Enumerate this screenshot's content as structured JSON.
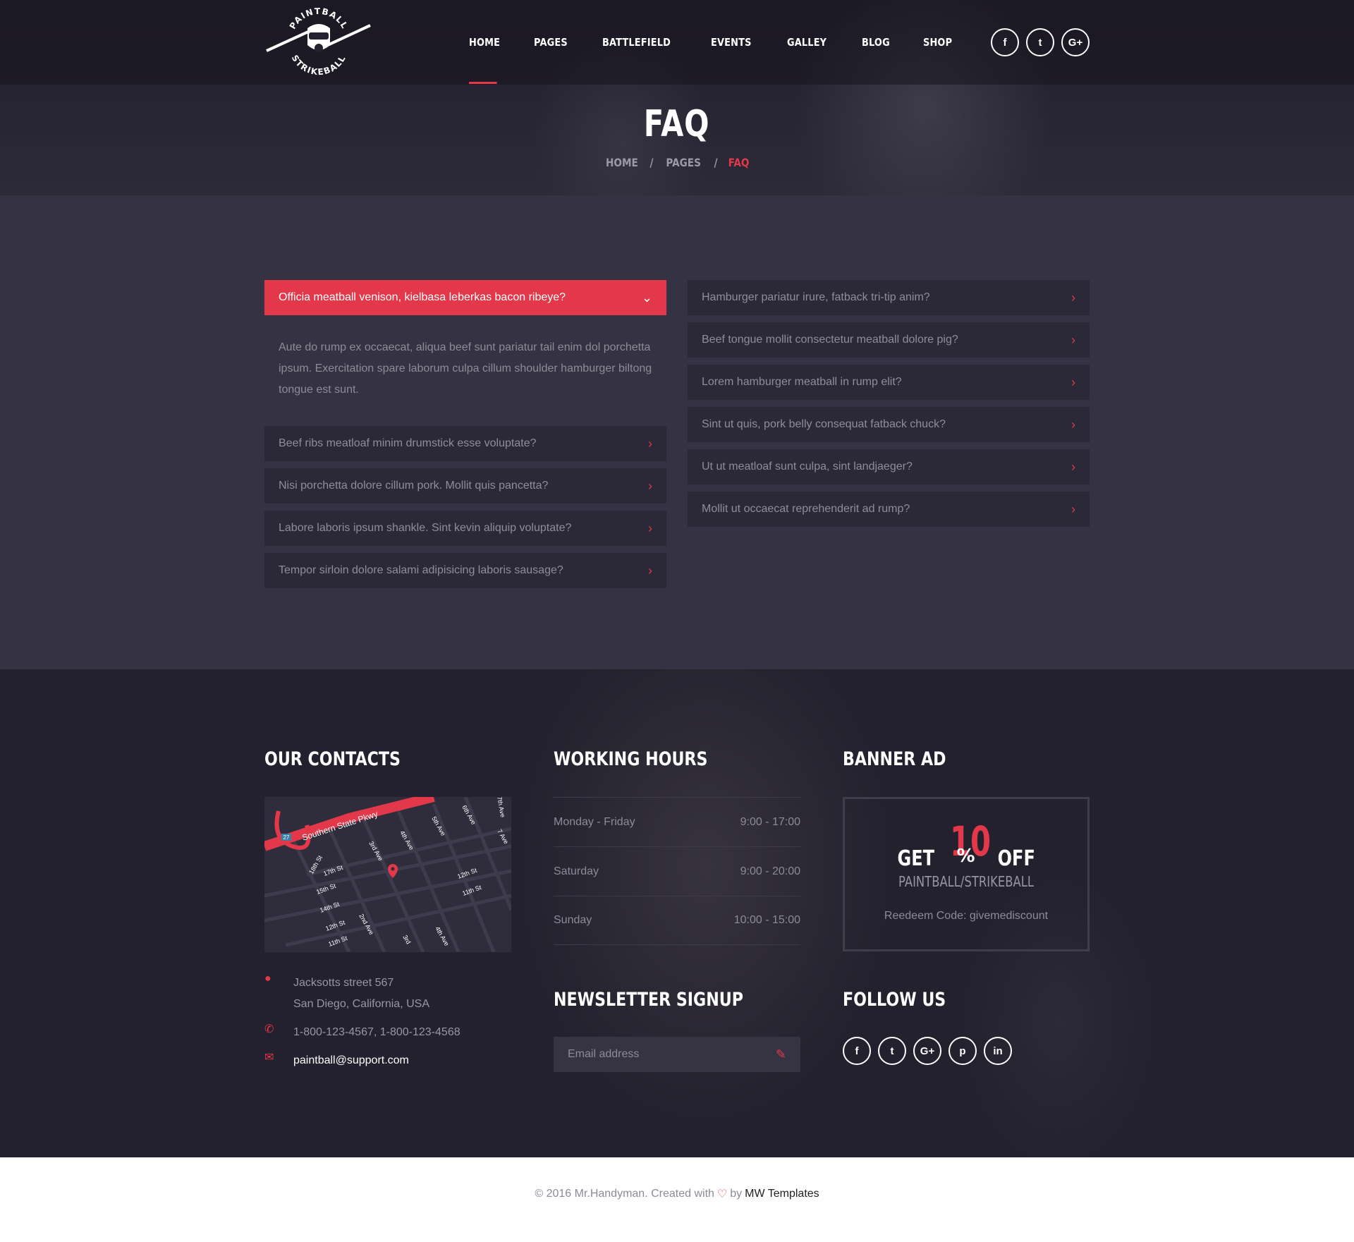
{
  "logo": {
    "top_text": "PAINTBALL",
    "bottom_text": "STRIKEBALL"
  },
  "nav": [
    {
      "label": "HOME",
      "active": true
    },
    {
      "label": "PAGES"
    },
    {
      "label": "BATTLEFIELD"
    },
    {
      "label": "EVENTS"
    },
    {
      "label": "GALLEY"
    },
    {
      "label": "BLOG"
    },
    {
      "label": "SHOP"
    }
  ],
  "social_top": [
    {
      "icon": "facebook-icon",
      "glyph": "f"
    },
    {
      "icon": "twitter-icon",
      "glyph": "t"
    },
    {
      "icon": "google-plus-icon",
      "glyph": "G+"
    }
  ],
  "page": {
    "title": "FAQ",
    "breadcrumb": [
      "HOME",
      "PAGES",
      "FAQ"
    ],
    "separator": "/"
  },
  "faq": {
    "left": [
      {
        "question": "Officia meatball venison, kielbasa leberkas bacon ribeye?",
        "open": true,
        "answer": "Aute do rump ex occaecat, aliqua beef sunt pariatur tail enim dol porchetta ipsum. Exercitation spare laborum culpa cillum shoulder hamburger biltong tongue est sunt."
      },
      {
        "question": "Beef ribs meatloaf minim drumstick esse voluptate?"
      },
      {
        "question": "Nisi porchetta dolore cillum pork. Mollit quis pancetta?"
      },
      {
        "question": "Labore laboris ipsum shankle. Sint kevin aliquip voluptate?"
      },
      {
        "question": "Tempor sirloin dolore salami adipisicing laboris sausage?"
      }
    ],
    "right": [
      {
        "question": "Hamburger pariatur irure, fatback tri-tip anim?"
      },
      {
        "question": "Beef tongue mollit consectetur meatball dolore pig?"
      },
      {
        "question": "Lorem hamburger meatball in rump elit?"
      },
      {
        "question": "Sint ut quis, pork belly consequat fatback chuck?"
      },
      {
        "question": "Ut ut meatloaf sunt culpa, sint landjaeger?"
      },
      {
        "question": "Mollit ut occaecat reprehenderit ad rump?"
      }
    ]
  },
  "footer": {
    "contacts": {
      "heading": "OUR CONTACTS",
      "map_labels": {
        "parkway": "Southern State Pkwy",
        "badge": "27",
        "streets": [
          "18th St",
          "17th St",
          "15th St",
          "14th St",
          "12th St",
          "11th St",
          "12th St",
          "11th St"
        ],
        "avenues": [
          "3rd Ave",
          "4th Ave",
          "5th Ave",
          "6th Ave",
          "7 Ave",
          "2nd Ave",
          "3rd",
          "4th Ave",
          "7th Ave"
        ]
      },
      "address_line1": "Jacksotts street 567",
      "address_line2": "San Diego, California, USA",
      "phone": "1-800-123-4567, 1-800-123-4568",
      "email": "paintball@support.com"
    },
    "hours": {
      "heading": "WORKING HOURS",
      "rows": [
        {
          "day": "Monday - Friday",
          "time": "9:00 - 17:00"
        },
        {
          "day": "Saturday",
          "time": "9:00 - 20:00"
        },
        {
          "day": "Sunday",
          "time": "10:00 - 15:00"
        }
      ]
    },
    "newsletter": {
      "heading": "NEWSLETTER SIGNUP",
      "placeholder": "Email address"
    },
    "banner": {
      "heading": "BANNER AD",
      "get": "GET",
      "number": "10",
      "percent": "%",
      "off": "OFF",
      "subtitle": "PAINTBALL/STRIKEBALL",
      "code": "Reedeem Code: givemediscount"
    },
    "follow": {
      "heading": "FOLLOW US",
      "items": [
        {
          "icon": "facebook-icon",
          "glyph": "f"
        },
        {
          "icon": "twitter-icon",
          "glyph": "t"
        },
        {
          "icon": "google-plus-icon",
          "glyph": "G+"
        },
        {
          "icon": "pinterest-icon",
          "glyph": "p"
        },
        {
          "icon": "linkedin-icon",
          "glyph": "in"
        }
      ]
    }
  },
  "copyright": {
    "text": "© 2016 Mr.Handyman. Created with",
    "by": "by",
    "brand": "MW Templates"
  },
  "colors": {
    "accent": "#e3384a",
    "dark": "#23212d",
    "panel": "#353343",
    "item": "#2b2937"
  }
}
